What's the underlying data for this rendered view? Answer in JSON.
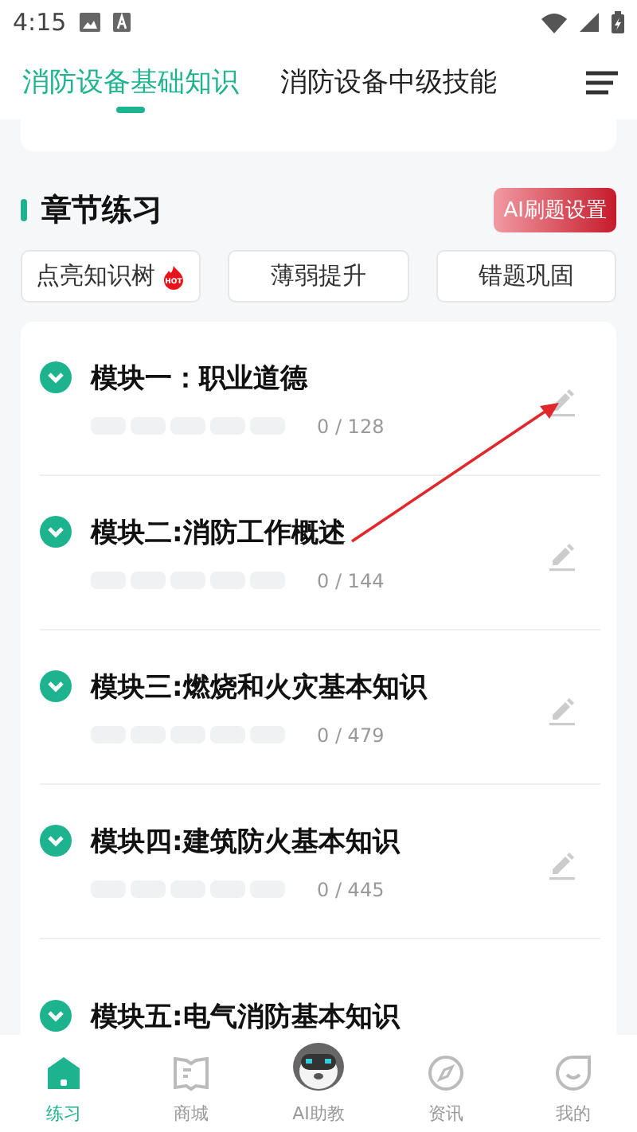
{
  "status_bar": {
    "time": "4:15"
  },
  "tabs": [
    {
      "label": "消防设备基础知识",
      "selected": true
    },
    {
      "label": "消防设备中级技能",
      "selected": false
    }
  ],
  "section": {
    "title": "章节练习",
    "ai_button": "AI刷题设置"
  },
  "quick_buttons": [
    {
      "label": "点亮知识树",
      "hot": true,
      "hot_label": "HOT"
    },
    {
      "label": "薄弱提升",
      "hot": false
    },
    {
      "label": "错题巩固",
      "hot": false
    }
  ],
  "modules": [
    {
      "title": "模块一：职业道德",
      "count": "0 / 128"
    },
    {
      "title": "模块二:消防工作概述",
      "count": "0 / 144"
    },
    {
      "title": "模块三:燃烧和火灾基本知识",
      "count": "0 / 479"
    },
    {
      "title": "模块四:建筑防火基本知识",
      "count": "0 / 445"
    },
    {
      "title": "模块五:电气消防基本知识"
    }
  ],
  "nav": [
    {
      "label": "练习",
      "kind": "home",
      "selected": true
    },
    {
      "label": "商城",
      "kind": "book",
      "selected": false
    },
    {
      "label": "AI助教",
      "kind": "robot",
      "selected": false
    },
    {
      "label": "资讯",
      "kind": "compass",
      "selected": false
    },
    {
      "label": "我的",
      "kind": "face",
      "selected": false
    }
  ]
}
